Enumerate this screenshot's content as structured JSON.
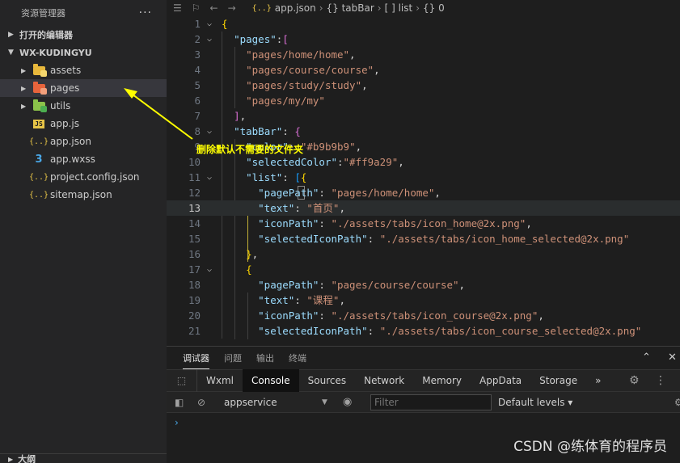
{
  "sidebar": {
    "title": "资源管理器",
    "more": "···",
    "open_editors": "打开的编辑器",
    "project": "WX-KUDINGYU",
    "outline": "大纲",
    "items": [
      {
        "label": "assets",
        "icon": "folder-assets-icon",
        "color": "#e8b83c",
        "badge": "#e8b83c"
      },
      {
        "label": "pages",
        "icon": "folder-pages-icon",
        "color": "#e8643c",
        "badge": "#e8643c"
      },
      {
        "label": "utils",
        "icon": "folder-utils-icon",
        "color": "#8bc34a",
        "badge": "#4caf50"
      },
      {
        "label": "app.js",
        "icon": "js-file-icon"
      },
      {
        "label": "app.json",
        "icon": "json-file-icon"
      },
      {
        "label": "app.wxss",
        "icon": "css-file-icon"
      },
      {
        "label": "project.config.json",
        "icon": "json-file-icon"
      },
      {
        "label": "sitemap.json",
        "icon": "json-file-icon"
      }
    ]
  },
  "breadcrumb": {
    "file": "app.json",
    "seg1": "{} tabBar",
    "seg2": "[ ] list",
    "seg3": "{} 0"
  },
  "code": {
    "ln": [
      "1",
      "2",
      "3",
      "4",
      "5",
      "6",
      "7",
      "8",
      "9",
      "10",
      "11",
      "12",
      "13",
      "14",
      "15",
      "16",
      "17",
      "18",
      "19",
      "20",
      "21"
    ],
    "l3": "\"pages/home/home\"",
    "l4": "\"pages/course/course\"",
    "l5": "\"pages/study/study\"",
    "l6": "\"pages/my/my\"",
    "l9_val": "\"#b9b9b9\"",
    "l10_key": "\"selectedColor\"",
    "l10_val": "\"#ff9a29\"",
    "l12_key": "\"pagePath\"",
    "l12_val": "\"pages/home/home\"",
    "l13_key": "\"text\"",
    "l13_val": "\"首页\"",
    "l14_key": "\"iconPath\"",
    "l14_val": "\"./assets/tabs/icon_home@2x.png\"",
    "l15_key": "\"selectedIconPath\"",
    "l15_val": "\"./assets/tabs/icon_home_selected@2x.png\"",
    "l18_key": "\"pagePath\"",
    "l18_val": "\"pages/course/course\"",
    "l19_key": "\"text\"",
    "l19_val": "\"课程\"",
    "l20_key": "\"iconPath\"",
    "l20_val": "\"./assets/tabs/icon_course@2x.png\"",
    "l21_key": "\"selectedIconPath\"",
    "l21_val": "\"./assets/tabs/icon_course_selected@2x.png\""
  },
  "annotation": {
    "text": "删除默认不需要的文件夹",
    "color": "#ffff00"
  },
  "panel": {
    "tabs": [
      "调试器",
      "问题",
      "输出",
      "终端"
    ],
    "devtools_tabs": [
      "Wxml",
      "Console",
      "Sources",
      "Network",
      "Memory",
      "AppData",
      "Storage"
    ],
    "more_tabs": "»",
    "context": "appservice",
    "filter_placeholder": "Filter",
    "levels": "Default levels ▾",
    "prompt": "›"
  },
  "watermark": "CSDN @练体育的程序员"
}
